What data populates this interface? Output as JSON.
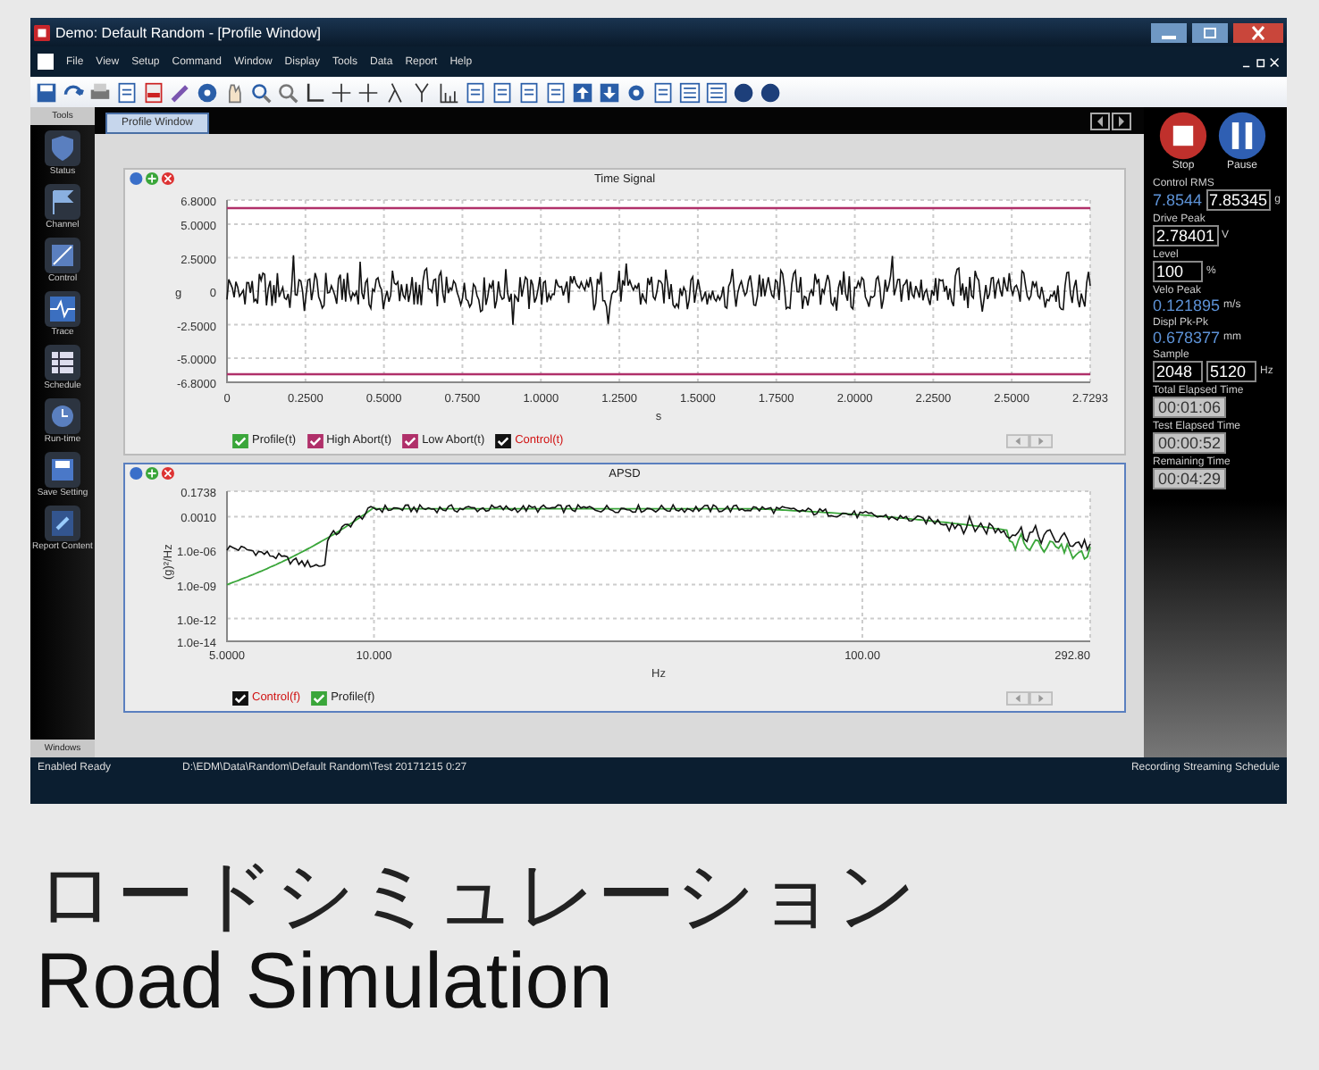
{
  "window": {
    "title": "Demo: Default Random - [Profile Window]"
  },
  "menu": [
    "File",
    "View",
    "Setup",
    "Command",
    "Window",
    "Display",
    "Tools",
    "Data",
    "Report",
    "Help"
  ],
  "sidebar": {
    "header": "Tools",
    "footer": "Windows",
    "items": [
      {
        "label": "Status"
      },
      {
        "label": "Channel"
      },
      {
        "label": "Control"
      },
      {
        "label": "Trace"
      },
      {
        "label": "Schedule"
      },
      {
        "label": "Run-time"
      },
      {
        "label": "Save Setting"
      },
      {
        "label": "Report Content"
      }
    ]
  },
  "tabs": [
    {
      "label": "Profile Window",
      "selected": true
    }
  ],
  "time_chart": {
    "title": "Time Signal",
    "ylabel": "g",
    "xlabel": "s",
    "y_ticks": [
      "6.8000",
      "5.0000",
      "2.5000",
      "0",
      "-2.5000",
      "-5.0000",
      "-6.8000"
    ],
    "x_ticks": [
      "0",
      "0.2500",
      "0.5000",
      "0.7500",
      "1.0000",
      "1.2500",
      "1.5000",
      "1.7500",
      "2.0000",
      "2.2500",
      "2.5000",
      "2.7293"
    ],
    "legend": [
      {
        "label": "Profile(t)",
        "checked": true,
        "color": "#3aa63a"
      },
      {
        "label": "High Abort(t)",
        "checked": true,
        "color": "#b0306a"
      },
      {
        "label": "Low Abort(t)",
        "checked": true,
        "color": "#b0306a"
      },
      {
        "label": "Control(t)",
        "checked": true,
        "color": "#111111"
      }
    ]
  },
  "apsd_chart": {
    "title": "APSD",
    "ylabel": "(g)²/Hz",
    "xlabel": "Hz",
    "y_ticks": [
      "0.1738",
      "0.0010",
      "1.0e-06",
      "1.0e-09",
      "1.0e-12",
      "1.0e-14"
    ],
    "x_ticks": [
      "5.0000",
      "10.000",
      "100.00",
      "292.80"
    ],
    "legend": [
      {
        "label": "Control(f)",
        "checked": true,
        "color": "#111111"
      },
      {
        "label": "Profile(f)",
        "checked": true,
        "color": "#3aa63a"
      }
    ]
  },
  "controls": [
    {
      "label": "Stop",
      "kind": "stop"
    },
    {
      "label": "Pause",
      "kind": "pause"
    }
  ],
  "readouts": [
    {
      "label": "Control RMS",
      "values": [
        {
          "text": "7.8544",
          "kind": "plain"
        },
        {
          "text": "7.85345",
          "kind": "field"
        }
      ],
      "unit": "g"
    },
    {
      "label": "Drive Peak",
      "values": [
        {
          "text": "2.78401",
          "kind": "field"
        }
      ],
      "unit": "V"
    },
    {
      "label": "Level",
      "values": [
        {
          "text": "100",
          "kind": "field"
        }
      ],
      "unit": "%"
    },
    {
      "label": "Velo Peak",
      "values": [
        {
          "text": "0.121895",
          "kind": "plain"
        }
      ],
      "unit": "m/s"
    },
    {
      "label": "Displ Pk-Pk",
      "values": [
        {
          "text": "0.678377",
          "kind": "plain"
        }
      ],
      "unit": "mm"
    },
    {
      "label": "Sample",
      "values": [
        {
          "text": "2048",
          "kind": "field"
        },
        {
          "text": "5120",
          "kind": "field"
        }
      ],
      "unit": "Hz"
    },
    {
      "label": "Total Elapsed Time",
      "values": [
        {
          "text": "00:01:06",
          "kind": "time"
        }
      ]
    },
    {
      "label": "Test Elapsed Time",
      "values": [
        {
          "text": "00:00:52",
          "kind": "time"
        }
      ]
    },
    {
      "label": "Remaining Time",
      "values": [
        {
          "text": "00:04:29",
          "kind": "time"
        }
      ]
    }
  ],
  "status_bar": [
    "Enabled  Ready",
    "D:\\EDM\\Data\\Random\\Default Random\\Test 20171215 0:27",
    "Recording  Streaming  Schedule"
  ],
  "caption": {
    "japanese": "ロードシミュレーション",
    "english": "Road Simulation"
  }
}
